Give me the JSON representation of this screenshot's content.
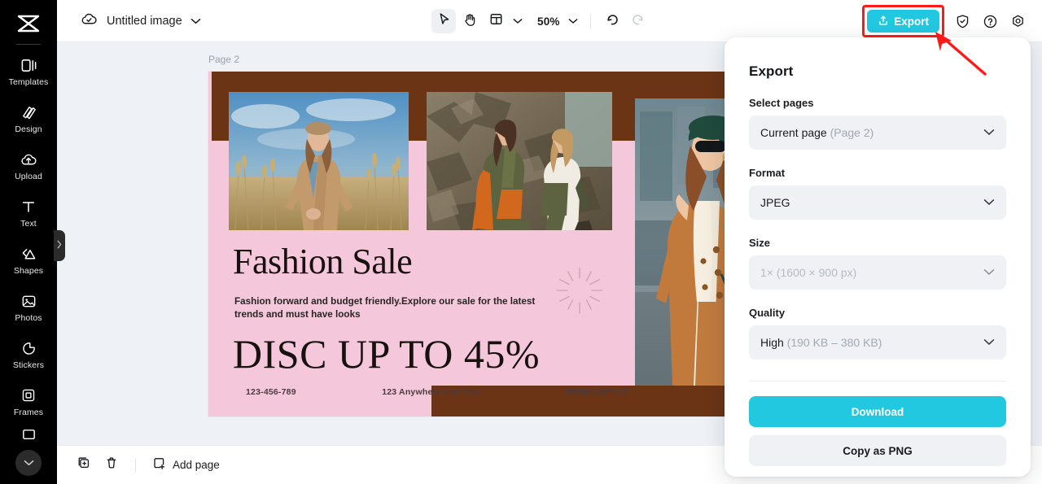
{
  "app": {
    "logo_icon": "capcut-logo-icon"
  },
  "sidebar": {
    "items": [
      {
        "label": "Templates",
        "icon": "templates-icon"
      },
      {
        "label": "Design",
        "icon": "design-icon"
      },
      {
        "label": "Upload",
        "icon": "upload-cloud-icon"
      },
      {
        "label": "Text",
        "icon": "text-icon"
      },
      {
        "label": "Shapes",
        "icon": "shapes-icon"
      },
      {
        "label": "Photos",
        "icon": "photos-icon"
      },
      {
        "label": "Stickers",
        "icon": "stickers-icon"
      },
      {
        "label": "Frames",
        "icon": "frames-icon"
      }
    ],
    "more_icon": "chevron-down-icon",
    "collapse_icon": "chevron-right-icon"
  },
  "topbar": {
    "cloud_icon": "cloud-saved-icon",
    "doc_title": "Untitled image",
    "title_chevron_icon": "chevron-down-icon",
    "tools": [
      {
        "name": "select-tool",
        "icon": "cursor-arrow-icon",
        "active": true
      },
      {
        "name": "hand-tool",
        "icon": "hand-icon",
        "active": false
      },
      {
        "name": "layout-tool",
        "icon": "layout-grid-icon",
        "active": false
      }
    ],
    "zoom_level": "50%",
    "undo_icon": "undo-icon",
    "redo_icon": "redo-icon",
    "export_label": "Export",
    "export_icon": "export-upload-icon",
    "export_color": "#22c8e0",
    "highlight_color": "#ff1a1a",
    "right_icons": [
      {
        "name": "shield-check-icon"
      },
      {
        "name": "help-circle-icon"
      },
      {
        "name": "settings-gear-icon"
      }
    ]
  },
  "canvas": {
    "page_label": "Page 2",
    "colors": {
      "pink": "#f4c8da",
      "brown": "#6b3415",
      "stage": "#eef1f5"
    },
    "design": {
      "title": "Fashion Sale",
      "subtitle": "Fashion forward and budget friendly.Explore our sale for the latest trends and must have looks",
      "discount": "DISC UP TO 45%",
      "footer": [
        "123-456-789",
        "123 Anywhere Any City",
        "WWW.CAPCUT"
      ],
      "photos": [
        {
          "name": "photo-woman-field",
          "alt": "Woman in tan trench coat in a wheat field"
        },
        {
          "name": "photo-two-women-rocks",
          "alt": "Two women in orange and olive outfits on rocks"
        },
        {
          "name": "photo-woman-street",
          "alt": "Woman in camel coat and green beret on a street"
        }
      ],
      "decoration": "sunburst-icon"
    }
  },
  "bottombar": {
    "duplicate_icon": "duplicate-page-icon",
    "delete_icon": "trash-icon",
    "add_page_icon": "add-page-icon",
    "add_page_label": "Add page"
  },
  "export_panel": {
    "title": "Export",
    "fields": [
      {
        "label": "Select pages",
        "value": "Current page",
        "value_muted": "(Page 2)",
        "disabled": false,
        "name": "select-pages-dropdown"
      },
      {
        "label": "Format",
        "value": "JPEG",
        "value_muted": "",
        "disabled": false,
        "name": "format-dropdown"
      },
      {
        "label": "Size",
        "value": "1×",
        "value_muted": "(1600 × 900 px)",
        "disabled": true,
        "name": "size-dropdown"
      },
      {
        "label": "Quality",
        "value": "High",
        "value_muted": "(190 KB – 380 KB)",
        "disabled": false,
        "name": "quality-dropdown"
      }
    ],
    "download_label": "Download",
    "download_color": "#22c8e0",
    "copy_label": "Copy as PNG"
  }
}
